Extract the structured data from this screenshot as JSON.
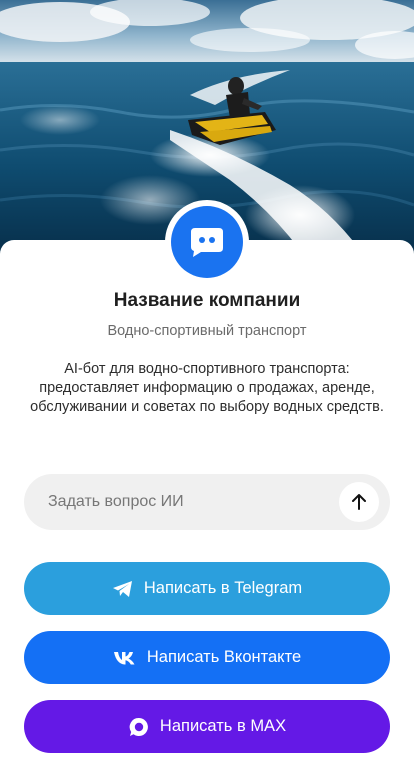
{
  "company": {
    "name": "Название компании",
    "category": "Водно-спортивный транспорт",
    "description": "AI-бот для водно-спортивного транспорта: предоставляет информацию о продажах, аренде, обслуживании и советах по выбору водных средств."
  },
  "ask": {
    "placeholder": "Задать вопрос ИИ",
    "send_icon": "arrow-up-icon"
  },
  "buttons": {
    "telegram": {
      "label": "Написать в Telegram",
      "icon": "telegram-icon",
      "color": "#2b9fdd"
    },
    "vk": {
      "label": "Написать Вконтакте",
      "icon": "vk-icon",
      "color": "#1470f5"
    },
    "max": {
      "label": "Написать в MAX",
      "icon": "max-icon",
      "color": "#6419e6"
    }
  },
  "colors": {
    "accent": "#1a73f0"
  }
}
